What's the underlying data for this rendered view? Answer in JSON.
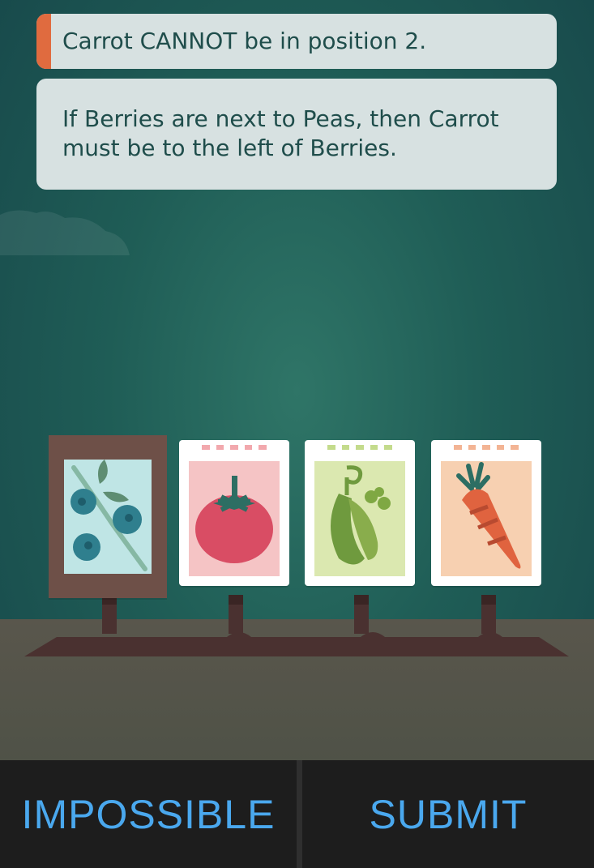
{
  "clues": [
    {
      "text": "Carrot CANNOT be in position 2."
    },
    {
      "text": "If Berries are next to Peas, then Carrot must be to the left of Berries."
    }
  ],
  "cards": [
    {
      "name": "Berries",
      "icon": "berries-icon",
      "panel_color": "#bfe5e5",
      "state": "placed"
    },
    {
      "name": "Tomato",
      "icon": "tomato-icon",
      "panel_color": "#f5c4c5",
      "dash_color": "#f2a8ad"
    },
    {
      "name": "Peas",
      "icon": "peas-icon",
      "panel_color": "#dbe8b0",
      "dash_color": "#c4db8c"
    },
    {
      "name": "Carrot",
      "icon": "carrot-icon",
      "panel_color": "#f7d0b1",
      "dash_color": "#f3b494"
    }
  ],
  "buttons": {
    "impossible": "IMPOSSIBLE",
    "submit": "SUBMIT"
  },
  "colors": {
    "accent": "#e06b3f",
    "button_text": "#4aa8ee"
  }
}
